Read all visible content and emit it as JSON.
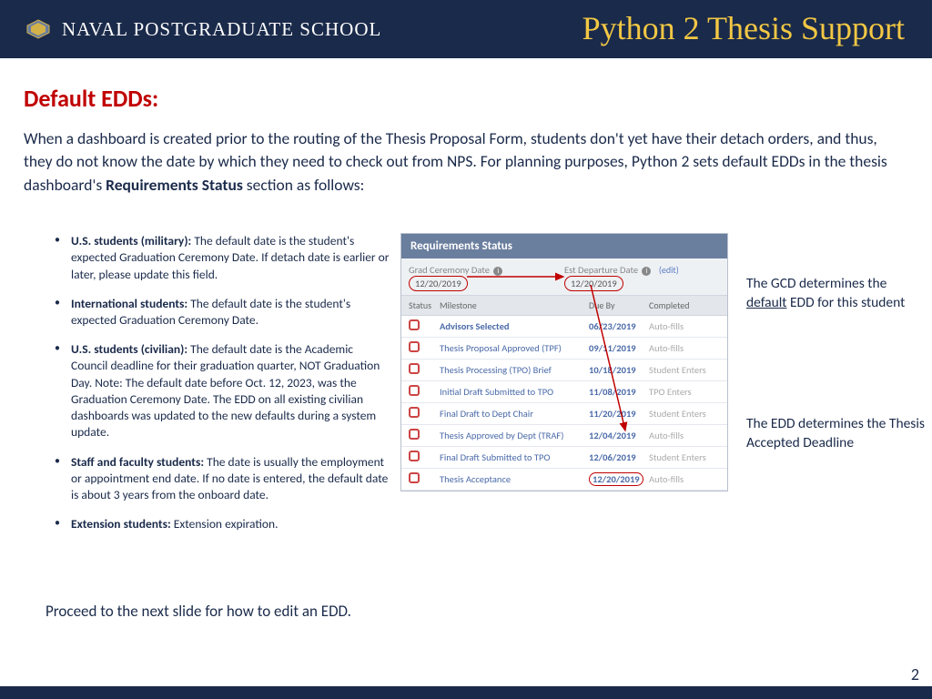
{
  "header": {
    "school": "NAVAL POSTGRADUATE SCHOOL",
    "title": "Python 2 Thesis Support"
  },
  "page_number": "2",
  "heading": "Default EDDs:",
  "intro": {
    "p1a": "When a dashboard is created prior to the routing of the Thesis Proposal Form, students don't yet have their detach orders, and thus, they do not know the date by which they need to check out from NPS. For planning purposes, Python 2 sets default EDDs in the thesis dashboard's ",
    "bold": "Requirements Status",
    "p1b": " section as follows:"
  },
  "bullets": [
    {
      "label": "U.S. students (military):",
      "text": " The default date is the student's expected Graduation Ceremony Date. If detach date is earlier or later, please update this field."
    },
    {
      "label": "International students:",
      "text": " The default date is the student's expected Graduation Ceremony Date."
    },
    {
      "label": "U.S. students (civilian):",
      "text": " The default date is the Academic Council deadline for their graduation quarter, NOT Graduation Day. Note: The default date before Oct. 12, 2023, was the Graduation Ceremony Date. The EDD on all existing civilian dashboards was updated to the new defaults during a system update."
    },
    {
      "label": "Staff and faculty students:",
      "text": " The date is usually the employment or appointment end date. If no date is entered, the default date is about 3 years from the onboard date."
    },
    {
      "label": "Extension students:",
      "text": " Extension expiration."
    }
  ],
  "screenshot": {
    "panel_title": "Requirements Status",
    "grad_label": "Grad Ceremony Date",
    "grad_date": "12/20/2019",
    "edd_label": "Est Departure Date",
    "edd_date": "12/20/2019",
    "edit": "(edit)",
    "cols": {
      "status": "Status",
      "milestone": "Milestone",
      "due": "Due By",
      "completed": "Completed"
    },
    "rows": [
      {
        "milestone": "Advisors Selected",
        "due": "06/23/2019",
        "completed": "Auto-fills",
        "first": true
      },
      {
        "milestone": "Thesis Proposal Approved (TPF)",
        "due": "09/11/2019",
        "completed": "Auto-fills"
      },
      {
        "milestone": "Thesis Processing (TPO) Brief",
        "due": "10/18/2019",
        "completed": "Student Enters"
      },
      {
        "milestone": "Initial Draft Submitted to TPO",
        "due": "11/08/2019",
        "completed": "TPO Enters"
      },
      {
        "milestone": "Final Draft to Dept Chair",
        "due": "11/20/2019",
        "completed": "Student Enters"
      },
      {
        "milestone": "Thesis Approved by Dept (TRAF)",
        "due": "12/04/2019",
        "completed": "Auto-fills"
      },
      {
        "milestone": "Final Draft Submitted to TPO",
        "due": "12/06/2019",
        "completed": "Student Enters"
      },
      {
        "milestone": "Thesis Acceptance",
        "due": "12/20/2019",
        "completed": "Auto-fills",
        "circled": true
      }
    ]
  },
  "notes": {
    "top_a": "The GCD determines the ",
    "top_u": "default",
    "top_b": " EDD for this student",
    "bottom": "The EDD determines the Thesis Accepted Deadline"
  },
  "proceed": "Proceed to the next slide for how to edit an EDD."
}
